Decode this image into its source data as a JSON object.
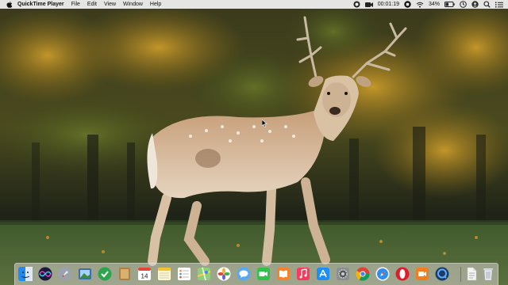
{
  "menubar": {
    "app_name": "QuickTime Player",
    "menus": [
      "File",
      "Edit",
      "View",
      "Window",
      "Help"
    ],
    "recording_time": "00:01:19",
    "battery": "34%"
  },
  "dock": {
    "apps": [
      {
        "id": "finder",
        "icon": "finder-icon"
      },
      {
        "id": "siri",
        "icon": "siri-icon"
      },
      {
        "id": "launchpad",
        "icon": "launchpad-rocket-icon"
      },
      {
        "id": "preview",
        "icon": "preview-icon"
      },
      {
        "id": "tickets",
        "icon": "green-check-icon"
      },
      {
        "id": "notefile",
        "icon": "brown-notebook-icon"
      },
      {
        "id": "calendar",
        "icon": "calendar-icon",
        "badge": "14"
      },
      {
        "id": "notes",
        "icon": "notes-icon"
      },
      {
        "id": "reminders",
        "icon": "reminders-icon"
      },
      {
        "id": "maps",
        "icon": "maps-icon"
      },
      {
        "id": "photos",
        "icon": "photos-icon"
      },
      {
        "id": "messages",
        "icon": "messages-icon"
      },
      {
        "id": "facetime",
        "icon": "facetime-icon"
      },
      {
        "id": "books",
        "icon": "books-icon"
      },
      {
        "id": "music",
        "icon": "music-icon"
      },
      {
        "id": "appstore",
        "icon": "app-store-icon"
      },
      {
        "id": "preferences",
        "icon": "system-preferences-icon"
      },
      {
        "id": "chrome",
        "icon": "chrome-icon"
      },
      {
        "id": "safari",
        "icon": "safari-icon"
      },
      {
        "id": "opera",
        "icon": "opera-icon"
      },
      {
        "id": "camera",
        "icon": "camera-icon"
      },
      {
        "id": "quicktime",
        "icon": "quicktime-icon"
      },
      {
        "id": "document",
        "icon": "document-icon"
      },
      {
        "id": "trash",
        "icon": "trash-icon"
      }
    ]
  }
}
